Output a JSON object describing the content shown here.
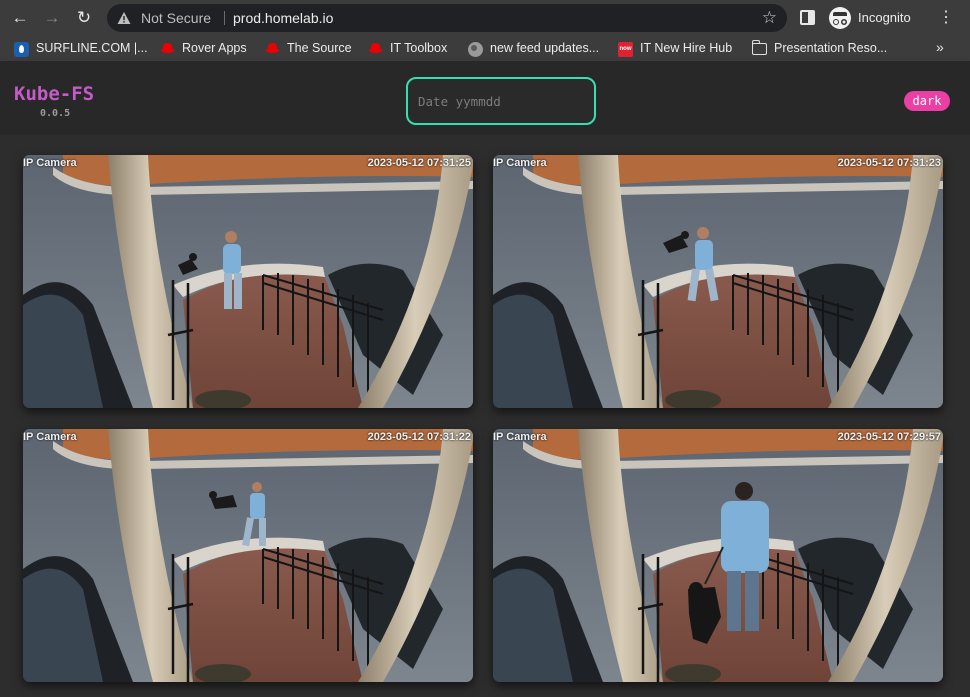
{
  "browser": {
    "security_label": "Not Secure",
    "url": "prod.homelab.io",
    "profile_label": "Incognito"
  },
  "bookmarks": [
    {
      "label": "SURFLINE.COM |...",
      "icon": "surfline-icon"
    },
    {
      "label": "Rover Apps",
      "icon": "redhat-icon"
    },
    {
      "label": "The Source",
      "icon": "redhat-icon"
    },
    {
      "label": "IT Toolbox",
      "icon": "redhat-icon"
    },
    {
      "label": "new feed updates...",
      "icon": "globe-icon"
    },
    {
      "label": "IT New Hire Hub",
      "icon": "servicenow-icon",
      "icon_text": "now"
    },
    {
      "label": "Presentation Reso...",
      "icon": "folder-icon"
    }
  ],
  "app": {
    "title": "Kube-FS",
    "version": "0.0.5",
    "date_placeholder": "Date yymmdd",
    "theme_toggle_label": "dark",
    "accent_colors": {
      "title": "#c55bc9",
      "input_border": "#33e0b0",
      "toggle": "#ea3fa4"
    }
  },
  "snapshots": [
    {
      "label": "IP Camera",
      "timestamp": "2023-05-12 07:31:25"
    },
    {
      "label": "IP Camera",
      "timestamp": "2023-05-12 07:31:23"
    },
    {
      "label": "IP Camera",
      "timestamp": "2023-05-12 07:31:22"
    },
    {
      "label": "IP Camera",
      "timestamp": "2023-05-12 07:29:57"
    }
  ]
}
